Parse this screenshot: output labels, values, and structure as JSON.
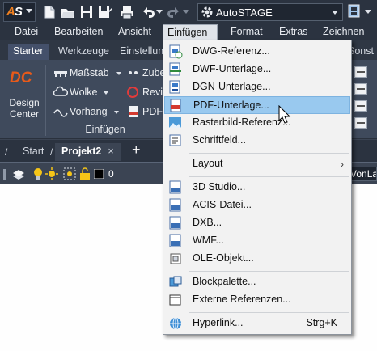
{
  "titlebar": {
    "logo_text_1": "A",
    "logo_text_2": "S",
    "workspace": "AutoSTAGE",
    "icons": [
      "new-icon",
      "open-icon",
      "save-icon",
      "save-as-icon",
      "print-icon",
      "undo-icon",
      "redo-icon",
      "gear-icon",
      "workspace-switch-icon"
    ]
  },
  "menubar": {
    "items": [
      "Datei",
      "Bearbeiten",
      "Ansicht",
      "Einfügen",
      "Format",
      "Extras",
      "Zeichnen"
    ],
    "active": "Einfügen"
  },
  "ribbon": {
    "tabs": [
      "Starter",
      "Werkzeuge",
      "Einstellun",
      "Sonst Attr"
    ],
    "selected_tab": "Starter",
    "design_center": [
      "Design",
      "Center"
    ],
    "rows": [
      {
        "label": "Maßstab",
        "icon": "scale-icon"
      },
      {
        "label": "Wolke",
        "icon": "cloud-icon"
      },
      {
        "label": "Vorhang",
        "icon": "curtain-icon"
      }
    ],
    "rows2": [
      {
        "label": "Zube",
        "icon": "accessory-icon"
      },
      {
        "label": "Revis",
        "icon": "revision-icon"
      },
      {
        "label": "PDF",
        "icon": "pdf-icon"
      }
    ],
    "panel_title": "Einfügen"
  },
  "filetabs": {
    "tabs": [
      {
        "label": "Start"
      },
      {
        "label": "Projekt2",
        "close": "×"
      }
    ],
    "plus": "+"
  },
  "layerbar": {
    "layer_name": "0",
    "combo_value": "VonLa"
  },
  "dropdown": {
    "items": [
      {
        "label": "DWG-Referenz...",
        "icon": "dwg-reference-icon"
      },
      {
        "label": "DWF-Unterlage...",
        "icon": "dwf-underlay-icon"
      },
      {
        "label": "DGN-Unterlage...",
        "icon": "dgn-underlay-icon"
      },
      {
        "label": "PDF-Unterlage...",
        "icon": "pdf-underlay-icon",
        "hover": true
      },
      {
        "label": "Rasterbild-Referenz...",
        "icon": "raster-image-icon"
      },
      {
        "label": "Schriftfeld...",
        "icon": "field-icon"
      },
      {
        "label": "Layout",
        "submenu": "›"
      },
      {
        "label": "3D Studio...",
        "icon": "3ds-icon"
      },
      {
        "label": "ACIS-Datei...",
        "icon": "acis-icon"
      },
      {
        "label": "DXB...",
        "icon": "dxb-icon"
      },
      {
        "label": "WMF...",
        "icon": "wmf-icon"
      },
      {
        "label": "OLE-Objekt...",
        "icon": "ole-object-icon"
      },
      {
        "label": "Blockpalette...",
        "icon": "block-palette-icon"
      },
      {
        "label": "Externe Referenzen...",
        "icon": "external-references-icon"
      },
      {
        "label": "Hyperlink...",
        "icon": "hyperlink-icon",
        "shortcut": "Strg+K"
      }
    ]
  },
  "colors": {
    "accent_highlight": "#99c9ef",
    "titlebar_bg": "#2b3340",
    "ribbon_bg": "#3f4a5c",
    "logo_orange": "#f08020"
  }
}
